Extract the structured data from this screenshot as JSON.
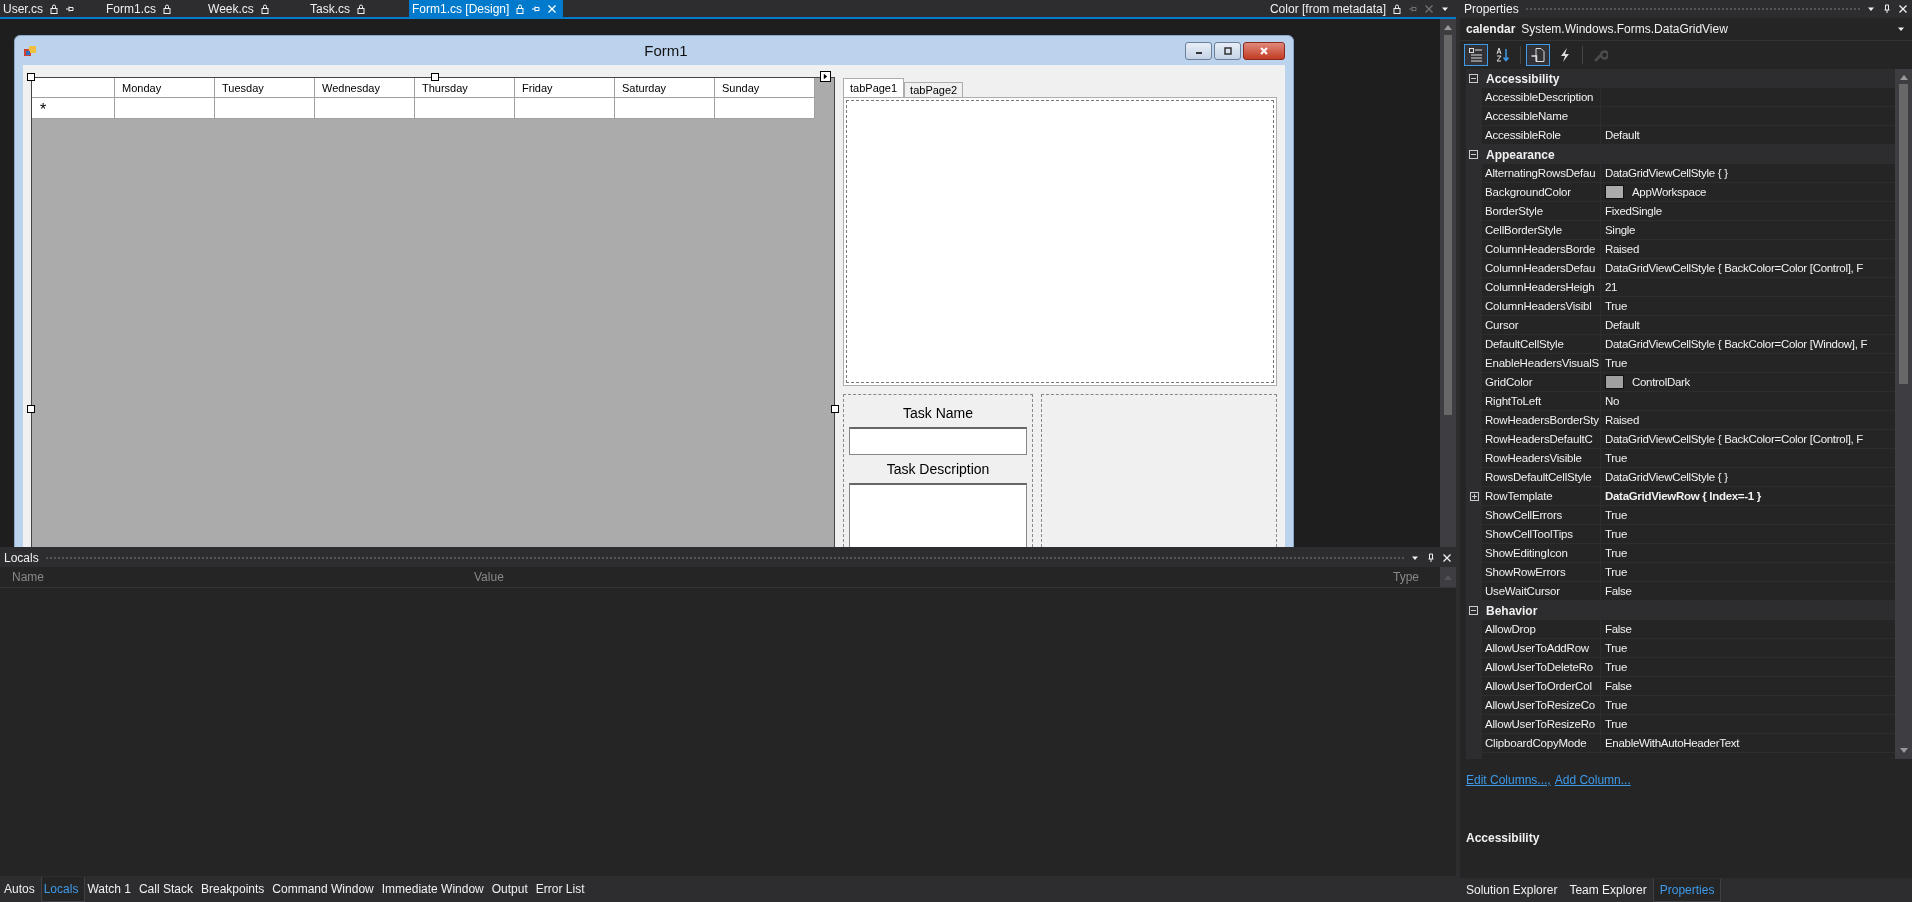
{
  "doc_tabs": [
    {
      "label": "User.cs",
      "selected": false,
      "pinned": true
    },
    {
      "label": "Form1.cs",
      "selected": false,
      "pinned": false
    },
    {
      "label": "Week.cs",
      "selected": false,
      "pinned": false
    },
    {
      "label": "Task.cs",
      "selected": false,
      "pinned": false
    },
    {
      "label": "Form1.cs [Design]",
      "selected": true,
      "pinned": true
    }
  ],
  "preview_tab": {
    "label": "Color [from metadata]"
  },
  "form": {
    "title": "Form1",
    "grid": {
      "columns": [
        "Monday",
        "Tuesday",
        "Wednesday",
        "Thursday",
        "Friday",
        "Saturday",
        "Sunday"
      ],
      "new_row_mark": "*"
    },
    "tabs": [
      {
        "label": "tabPage1",
        "selected": true
      },
      {
        "label": "tabPage2",
        "selected": false
      }
    ],
    "task_name_label": "Task Name",
    "task_description_label": "Task Description"
  },
  "properties": {
    "title": "Properties",
    "object_name": "calendar",
    "object_type": "System.Windows.Forms.DataGridView",
    "toolbar": [
      {
        "kind": "categorized",
        "selected": true,
        "disabled": false
      },
      {
        "kind": "alphabetical",
        "selected": false,
        "disabled": false
      },
      {
        "kind": "properties",
        "selected": true,
        "disabled": false
      },
      {
        "kind": "events",
        "selected": false,
        "disabled": false
      },
      {
        "kind": "pages",
        "selected": false,
        "disabled": true
      }
    ],
    "categories": [
      {
        "name": "Accessibility",
        "expanded": true,
        "rows": [
          {
            "name": "AccessibleDescription",
            "value": "",
            "kind": "text"
          },
          {
            "name": "AccessibleName",
            "value": "",
            "kind": "text"
          },
          {
            "name": "AccessibleRole",
            "value": "Default",
            "kind": "text"
          }
        ]
      },
      {
        "name": "Appearance",
        "expanded": true,
        "rows": [
          {
            "name": "AlternatingRowsDefau",
            "value": "DataGridViewCellStyle { }",
            "kind": "text"
          },
          {
            "name": "BackgroundColor",
            "value": "AppWorkspace",
            "kind": "color",
            "color": "#ababab"
          },
          {
            "name": "BorderStyle",
            "value": "FixedSingle",
            "kind": "text"
          },
          {
            "name": "CellBorderStyle",
            "value": "Single",
            "kind": "text"
          },
          {
            "name": "ColumnHeadersBorde",
            "value": "Raised",
            "kind": "text"
          },
          {
            "name": "ColumnHeadersDefau",
            "value": "DataGridViewCellStyle { BackColor=Color [Control], F",
            "kind": "text"
          },
          {
            "name": "ColumnHeadersHeigh",
            "value": "21",
            "kind": "text"
          },
          {
            "name": "ColumnHeadersVisibl",
            "value": "True",
            "kind": "text"
          },
          {
            "name": "Cursor",
            "value": "Default",
            "kind": "text"
          },
          {
            "name": "DefaultCellStyle",
            "value": "DataGridViewCellStyle { BackColor=Color [Window], F",
            "kind": "text"
          },
          {
            "name": "EnableHeadersVisualS",
            "value": "True",
            "kind": "text"
          },
          {
            "name": "GridColor",
            "value": "ControlDark",
            "kind": "color",
            "color": "#a0a0a0"
          },
          {
            "name": "RightToLeft",
            "value": "No",
            "kind": "text"
          },
          {
            "name": "RowHeadersBorderSty",
            "value": "Raised",
            "kind": "text"
          },
          {
            "name": "RowHeadersDefaultC",
            "value": "DataGridViewCellStyle { BackColor=Color [Control], F",
            "kind": "text"
          },
          {
            "name": "RowHeadersVisible",
            "value": "True",
            "kind": "text"
          },
          {
            "name": "RowsDefaultCellStyle",
            "value": "DataGridViewCellStyle { }",
            "kind": "text"
          },
          {
            "name": "RowTemplate",
            "value": "DataGridViewRow { Index=-1 }",
            "kind": "object"
          },
          {
            "name": "ShowCellErrors",
            "value": "True",
            "kind": "text"
          },
          {
            "name": "ShowCellToolTips",
            "value": "True",
            "kind": "text"
          },
          {
            "name": "ShowEditingIcon",
            "value": "True",
            "kind": "text"
          },
          {
            "name": "ShowRowErrors",
            "value": "True",
            "kind": "text"
          },
          {
            "name": "UseWaitCursor",
            "value": "False",
            "kind": "text"
          }
        ]
      },
      {
        "name": "Behavior",
        "expanded": true,
        "rows": [
          {
            "name": "AllowDrop",
            "value": "False",
            "kind": "text"
          },
          {
            "name": "AllowUserToAddRow",
            "value": "True",
            "kind": "text"
          },
          {
            "name": "AllowUserToDeleteRo",
            "value": "True",
            "kind": "text"
          },
          {
            "name": "AllowUserToOrderCol",
            "value": "False",
            "kind": "text"
          },
          {
            "name": "AllowUserToResizeCo",
            "value": "True",
            "kind": "text"
          },
          {
            "name": "AllowUserToResizeRo",
            "value": "True",
            "kind": "text"
          },
          {
            "name": "ClipboardCopyMode",
            "value": "EnableWithAutoHeaderText",
            "kind": "text"
          }
        ]
      }
    ],
    "links": [
      "Edit Columns...,",
      "Add Column..."
    ],
    "description_title": "Accessibility",
    "tabs": [
      {
        "label": "Solution Explorer",
        "selected": false
      },
      {
        "label": "Team Explorer",
        "selected": false
      },
      {
        "label": "Properties",
        "selected": true
      }
    ]
  },
  "locals": {
    "title": "Locals",
    "columns": [
      "Name",
      "Value",
      "Type"
    ]
  },
  "bottom_tabs": [
    {
      "label": "Autos",
      "selected": false
    },
    {
      "label": "Locals",
      "selected": true
    },
    {
      "label": "Watch 1",
      "selected": false
    },
    {
      "label": "Call Stack",
      "selected": false
    },
    {
      "label": "Breakpoints",
      "selected": false
    },
    {
      "label": "Command Window",
      "selected": false
    },
    {
      "label": "Immediate Window",
      "selected": false
    },
    {
      "label": "Output",
      "selected": false
    },
    {
      "label": "Error List",
      "selected": false
    }
  ]
}
